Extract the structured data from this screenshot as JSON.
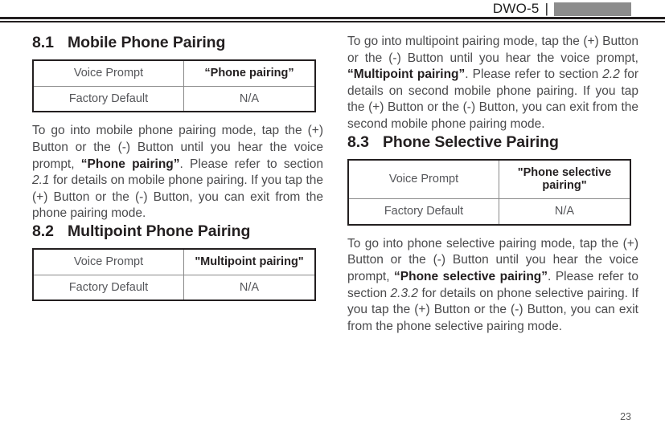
{
  "header": {
    "model": "DWO-5",
    "separator": "|",
    "redaction_color": "#8c8c8c"
  },
  "footer": {
    "page_number": "23"
  },
  "table_labels": {
    "voice_prompt": "Voice Prompt",
    "factory_default": "Factory Default",
    "not_applicable": "N/A"
  },
  "sections": [
    {
      "number": "8.1",
      "title": "Mobile Phone Pairing",
      "table": {
        "voice_prompt_label": "Voice Prompt",
        "voice_prompt_value": "“Phone pairing”",
        "factory_default_label": "Factory Default",
        "factory_default_value": "N/A"
      },
      "paragraph": {
        "part1": "To go into mobile phone pairing mode, tap the (+) Button or the (-) Button until you hear the voice prompt, ",
        "bold": "“Phone pairing”",
        "part2": ". Please refer to section ",
        "italic": "2.1",
        "part3": " for details on mobile phone pairing. If you tap the (+) Button or the (-) Button, you can exit from the phone pairing mode."
      }
    },
    {
      "number": "8.2",
      "title": "Multipoint Phone Pairing",
      "table": {
        "voice_prompt_label": "Voice Prompt",
        "voice_prompt_value": "\"Multipoint pairing\"",
        "factory_default_label": "Factory Default",
        "factory_default_value": "N/A"
      },
      "paragraph": {
        "part1": "To go into multipoint pairing mode, tap the (+) Button or the (-) Button until you hear the voice prompt, ",
        "bold": "“Multipoint pairing”",
        "part2": ". Please refer to section ",
        "italic": "2.2",
        "part3": " for details on second mobile phone pairing. If you tap the (+) Button or the (-) Button, you can exit from the second mobile phone pairing mode."
      }
    },
    {
      "number": "8.3",
      "title": "Phone Selective Pairing",
      "table": {
        "voice_prompt_label": "Voice Prompt",
        "voice_prompt_value": "\"Phone selective pairing\"",
        "factory_default_label": "Factory Default",
        "factory_default_value": "N/A"
      },
      "paragraph": {
        "part1": "To go into phone selective pairing mode, tap the (+) Button or the (-) Button until you hear the voice prompt, ",
        "bold": "“Phone selective pairing”",
        "part2": ". Please refer to section ",
        "italic": "2.3.2",
        "part3": " for details on phone selective pairing. If you tap the (+) Button or the (-) Button, you can exit from the phone selective pairing mode."
      }
    }
  ]
}
